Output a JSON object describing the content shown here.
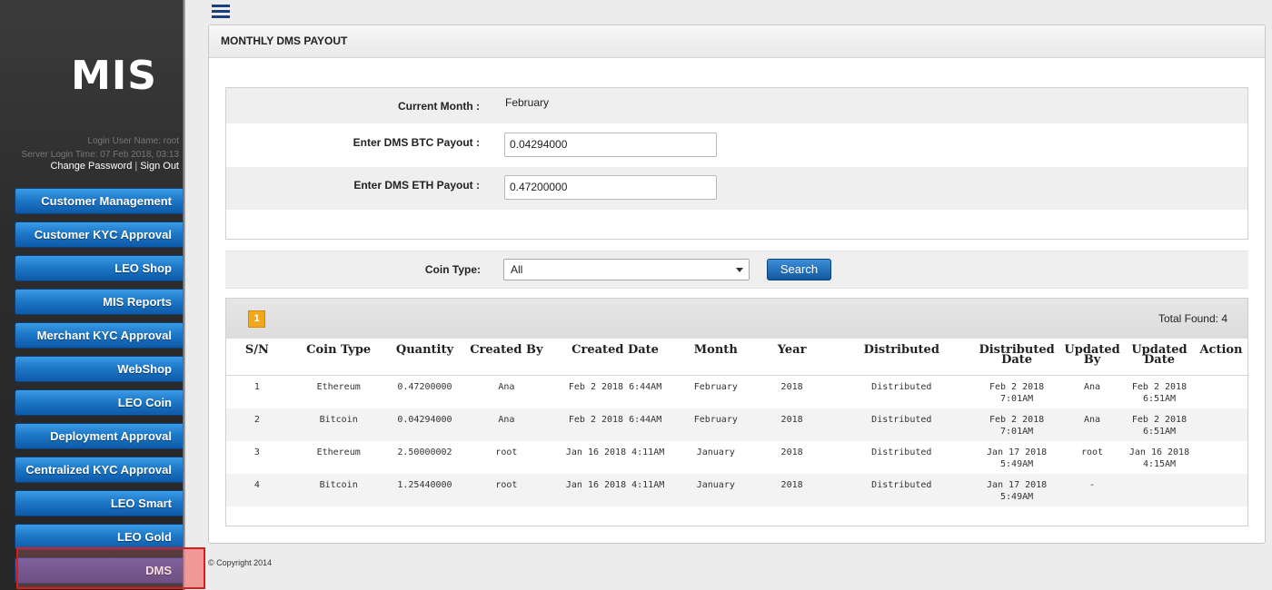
{
  "app": {
    "logo": "MIS",
    "login_user": "Login User Name: root",
    "login_time": "Server Login Time: 07 Feb 2018, 03:13",
    "change_password": "Change Password",
    "separator": "|",
    "sign_out": "Sign Out"
  },
  "sidebar": {
    "items": [
      {
        "label": "Customer Management"
      },
      {
        "label": "Customer KYC Approval"
      },
      {
        "label": "LEO Shop"
      },
      {
        "label": "MIS Reports"
      },
      {
        "label": "Merchant KYC Approval"
      },
      {
        "label": "WebShop"
      },
      {
        "label": "LEO Coin"
      },
      {
        "label": "Deployment Approval"
      },
      {
        "label": "Centralized KYC Approval"
      },
      {
        "label": "LEO Smart"
      },
      {
        "label": "LEO Gold"
      },
      {
        "label": "DMS"
      }
    ],
    "active": "DMS"
  },
  "panel": {
    "title": "MONTHLY DMS PAYOUT"
  },
  "form": {
    "current_month_label": "Current Month :",
    "current_month_value": "February",
    "btc_label": "Enter DMS BTC Payout :",
    "btc_value": "0.04294000",
    "eth_label": "Enter DMS ETH Payout :",
    "eth_value": "0.47200000"
  },
  "filter": {
    "coin_type_label": "Coin Type:",
    "coin_type_selected": "All",
    "search_label": "Search"
  },
  "grid": {
    "page": "1",
    "total_found": "Total Found: 4",
    "columns": [
      "S/N",
      "Coin Type",
      "Quantity",
      "Created By",
      "Created Date",
      "Month",
      "Year",
      "Distributed",
      "Distributed Date",
      "Updated By",
      "Updated Date",
      "Action"
    ],
    "rows": [
      [
        "1",
        "Ethereum",
        "0.47200000",
        "Ana",
        "Feb 2 2018 6:44AM",
        "February",
        "2018",
        "Distributed",
        "Feb 2 2018 7:01AM",
        "Ana",
        "Feb 2 2018 6:51AM",
        ""
      ],
      [
        "2",
        "Bitcoin",
        "0.04294000",
        "Ana",
        "Feb 2 2018 6:44AM",
        "February",
        "2018",
        "Distributed",
        "Feb 2 2018 7:01AM",
        "Ana",
        "Feb 2 2018 6:51AM",
        ""
      ],
      [
        "3",
        "Ethereum",
        "2.50000002",
        "root",
        "Jan 16 2018 4:11AM",
        "January",
        "2018",
        "Distributed",
        "Jan 17 2018 5:49AM",
        "root",
        "Jan 16 2018 4:15AM",
        ""
      ],
      [
        "4",
        "Bitcoin",
        "1.25440000",
        "root",
        "Jan 16 2018 4:11AM",
        "January",
        "2018",
        "Distributed",
        "Jan 17 2018 5:49AM",
        "-",
        "",
        ""
      ]
    ]
  },
  "footer": {
    "copyright": "© Copyright 2014"
  },
  "colors": {
    "menu_blue": "#1e78c8",
    "active_purple": "#444488",
    "highlight_red": "#d81e1e",
    "page_orange": "#f0a81c"
  }
}
